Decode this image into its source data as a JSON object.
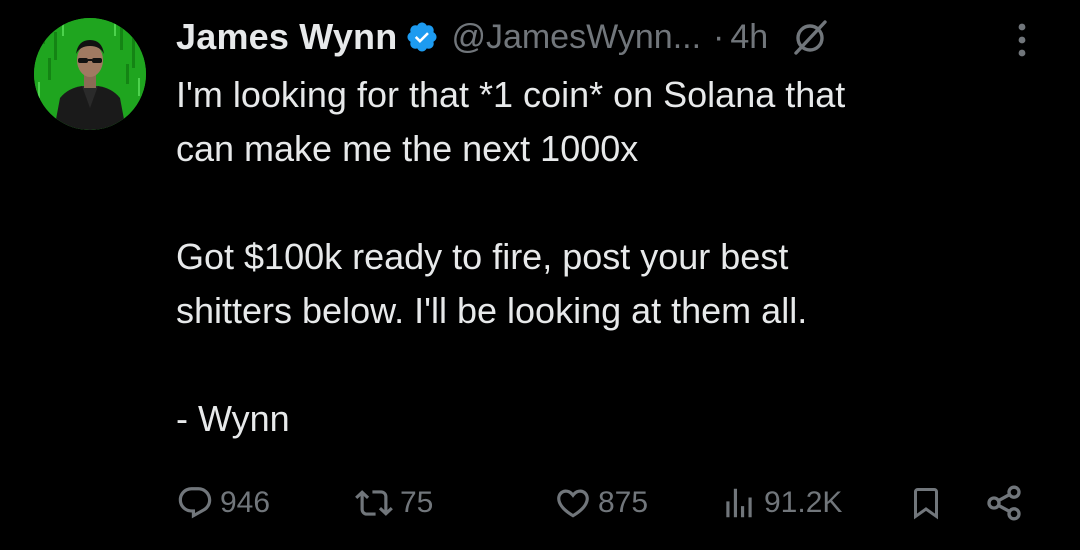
{
  "author": {
    "name": "James Wynn",
    "handle": "@JamesWynn...",
    "separator": "·",
    "time": "4h",
    "verified": true
  },
  "tweet": {
    "line1": "I'm looking for that *1 coin* on Solana that",
    "line2": "can make me the next 1000x",
    "line3": "Got $100k ready to fire, post your best",
    "line4": "shitters below. I'll be looking at them all.",
    "line5": "- Wynn"
  },
  "stats": {
    "replies": "946",
    "retweets": "75",
    "likes": "875",
    "views": "91.2K"
  },
  "icons": {
    "verified": "verified-badge-icon",
    "grok": "grok-icon",
    "more": "more-vertical-icon",
    "reply": "reply-icon",
    "retweet": "retweet-icon",
    "like": "heart-icon",
    "views": "views-icon",
    "bookmark": "bookmark-icon",
    "share": "share-icon"
  },
  "colors": {
    "background": "#000000",
    "text": "#e7e9ea",
    "muted": "#71767b",
    "verified": "#1d9bf0",
    "avatar_bg": "#1fa51f"
  }
}
